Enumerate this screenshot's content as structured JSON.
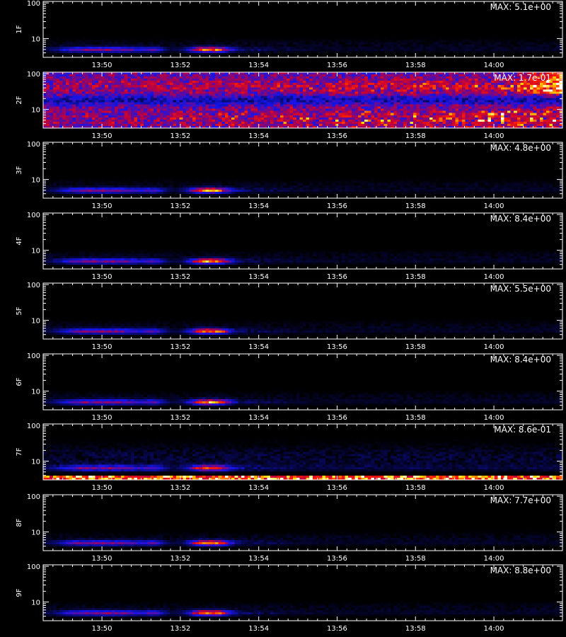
{
  "chart_data": [
    {
      "type": "heatmap",
      "ylabel": "1F",
      "max_label": "MAX: 5.1e+00",
      "pattern": "burst"
    },
    {
      "type": "heatmap",
      "ylabel": "2F",
      "max_label": "MAX: 1.7e-01",
      "pattern": "noise"
    },
    {
      "type": "heatmap",
      "ylabel": "3F",
      "max_label": "MAX: 4.8e+00",
      "pattern": "burst"
    },
    {
      "type": "heatmap",
      "ylabel": "4F",
      "max_label": "MAX: 8.4e+00",
      "pattern": "burst"
    },
    {
      "type": "heatmap",
      "ylabel": "5F",
      "max_label": "MAX: 5.5e+00",
      "pattern": "burst"
    },
    {
      "type": "heatmap",
      "ylabel": "6F",
      "max_label": "MAX: 8.4e+00",
      "pattern": "burst"
    },
    {
      "type": "heatmap",
      "ylabel": "7F",
      "max_label": "MAX: 8.6e-01",
      "pattern": "band"
    },
    {
      "type": "heatmap",
      "ylabel": "8F",
      "max_label": "MAX: 7.7e+00",
      "pattern": "burst"
    },
    {
      "type": "heatmap",
      "ylabel": "9F",
      "max_label": "MAX: 8.8e+00",
      "pattern": "burst"
    }
  ],
  "x_axis": {
    "range": [
      "13:48:30",
      "14:01:45"
    ],
    "ticks": [
      "13:50",
      "13:52",
      "13:54",
      "13:56",
      "13:58",
      "14:00"
    ]
  },
  "y_axis": {
    "scale": "log",
    "range": [
      3,
      110
    ],
    "ticks": [
      "10",
      "100"
    ]
  },
  "burst_window": {
    "weak": [
      "13:49:00",
      "13:51:00"
    ],
    "small": [
      "13:51:10",
      "13:51:30"
    ],
    "strong": [
      "13:52:20",
      "13:53:10"
    ]
  },
  "colors": {
    "background": "#000000",
    "axis": "#ffffff",
    "colormap": "blue-red-yellow-white"
  }
}
